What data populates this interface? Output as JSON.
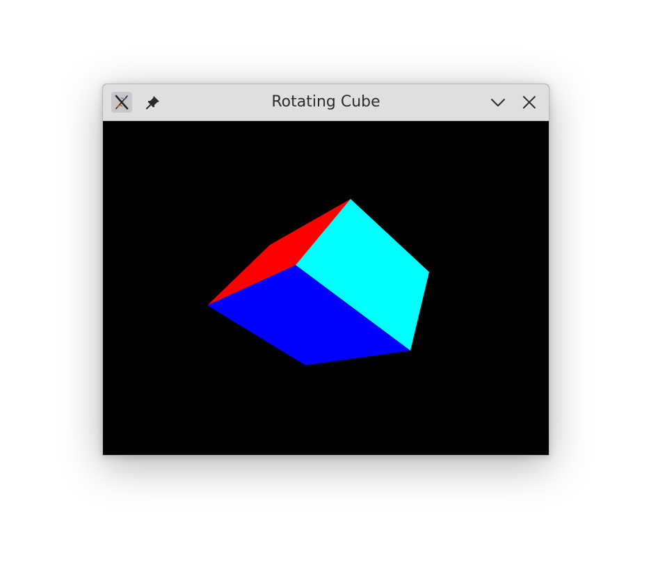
{
  "window": {
    "title": "Rotating Cube"
  },
  "titlebar": {
    "app_icon": "x-app-icon",
    "pin_icon": "pin-icon",
    "minimize_icon": "chevron-down-icon",
    "close_icon": "close-icon"
  },
  "scene": {
    "background": "#000000",
    "faces": [
      {
        "name": "top-face",
        "color": "#ff0000"
      },
      {
        "name": "right-face",
        "color": "#00ffff"
      },
      {
        "name": "front-face",
        "color": "#0000ff"
      }
    ]
  }
}
